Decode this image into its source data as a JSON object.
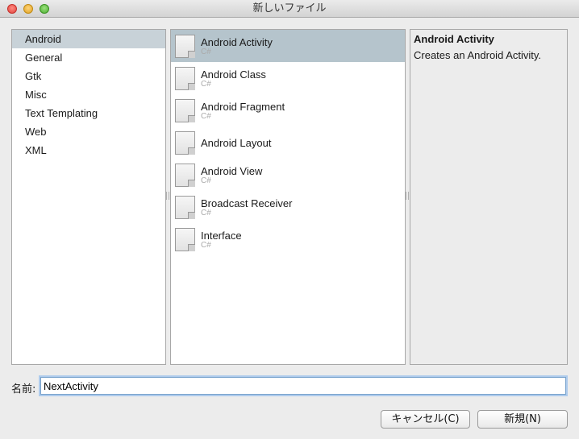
{
  "window": {
    "title": "新しいファイル"
  },
  "categories": [
    {
      "label": "Android",
      "selected": true
    },
    {
      "label": "General",
      "selected": false
    },
    {
      "label": "Gtk",
      "selected": false
    },
    {
      "label": "Misc",
      "selected": false
    },
    {
      "label": "Text Templating",
      "selected": false
    },
    {
      "label": "Web",
      "selected": false
    },
    {
      "label": "XML",
      "selected": false
    }
  ],
  "templates": [
    {
      "name": "Android Activity",
      "lang": "C#",
      "selected": true,
      "icon": "file-icon"
    },
    {
      "name": "Android Class",
      "lang": "C#",
      "selected": false,
      "icon": "file-icon"
    },
    {
      "name": "Android Fragment",
      "lang": "C#",
      "selected": false,
      "icon": "file-icon"
    },
    {
      "name": "Android Layout",
      "lang": "",
      "selected": false,
      "icon": "file-icon"
    },
    {
      "name": "Android View",
      "lang": "C#",
      "selected": false,
      "icon": "file-icon"
    },
    {
      "name": "Broadcast Receiver",
      "lang": "C#",
      "selected": false,
      "icon": "file-icon"
    },
    {
      "name": "Interface",
      "lang": "C#",
      "selected": false,
      "icon": "file-icon"
    }
  ],
  "description": {
    "title": "Android Activity",
    "text": "Creates an Android Activity."
  },
  "name_field": {
    "label": "名前:",
    "value": "NextActivity"
  },
  "buttons": {
    "cancel": "キャンセル(C)",
    "new": "新規(N)"
  },
  "colors": {
    "selection": "#b5c4cc",
    "focus_ring": "#aecbec"
  }
}
